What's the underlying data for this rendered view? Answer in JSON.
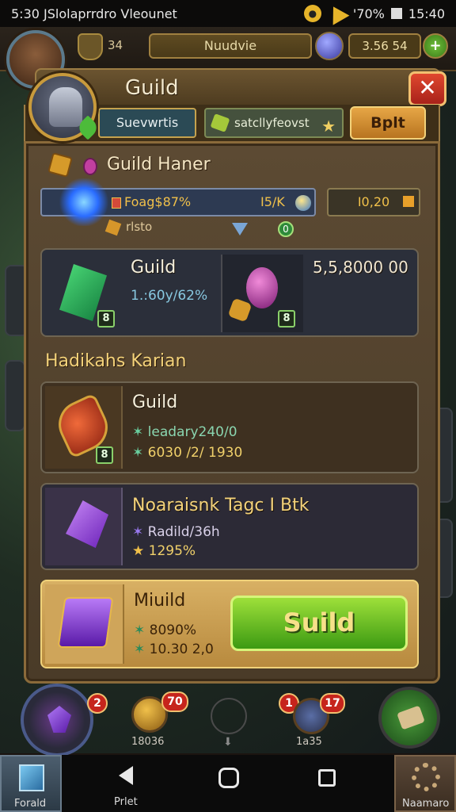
{
  "status_bar": {
    "time_left": "5:30",
    "carrier_text": "JSlolaprrdro Vleounet",
    "battery": "'70%",
    "time_right": "15:40"
  },
  "hud": {
    "level": "34",
    "player_name": "Nuudvie",
    "coins": "3.56 54",
    "add_label": "+"
  },
  "modal": {
    "title": "Guild",
    "close_label": "✕",
    "tabs": [
      {
        "label": "Suevwrtis"
      },
      {
        "label": "satcllyfeovst"
      },
      {
        "label": "Bplt"
      }
    ]
  },
  "guild_header": {
    "title": "Guild Haner",
    "stat_1": "Foag$87%",
    "stat_2": "I5/K",
    "stat_box": "I0,20",
    "sub_text": "rlsto",
    "badge": "0"
  },
  "top_card": {
    "name": "Guild",
    "sub": "1.:60y/62%",
    "count_1": "8",
    "count_2": "8",
    "value": "5,5,8000 00"
  },
  "section_title": "Hadikahs Karian",
  "items": [
    {
      "name": "Guild",
      "line_1": "leadary240/0",
      "line_2": "6030 /2/ 1930",
      "count": "8"
    },
    {
      "name": "Noaraisnk Tagc I Btk",
      "line_1": "Radild/36h",
      "line_2": "1295%"
    },
    {
      "name": "Miuild",
      "line_1": "8090%",
      "line_2": "10.30 2,0"
    }
  ],
  "build_button": "Suild",
  "bottom_hud": {
    "badge_1": "2",
    "badge_2": "70",
    "badge_3": "1",
    "badge_4": "17",
    "label_1": "18036",
    "label_2": "1a35"
  },
  "nav": {
    "left_label": "Forald",
    "mid_label": "Prlet",
    "right_label": "Naamaro"
  },
  "colors": {
    "build_green": "#5cbf1e",
    "close_red": "#d03a26",
    "gold": "#f0c04a"
  }
}
